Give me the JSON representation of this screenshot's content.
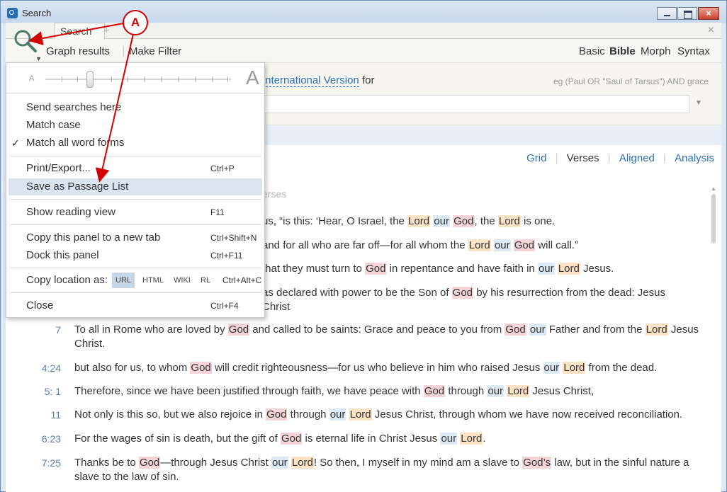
{
  "window": {
    "title": "Search"
  },
  "tabs": {
    "active_label": "Search",
    "add_label": "+",
    "close_label": "×"
  },
  "toolbar": {
    "graph_results": "Graph results",
    "make_filter": "Make Filter",
    "modes": [
      "Basic",
      "Bible",
      "Morph",
      "Syntax"
    ],
    "active_mode": "Bible"
  },
  "search": {
    "version": "International Version",
    "for_label": "for",
    "example": "eg (Paul OR \"Saul of Tarsus\") AND grace",
    "query": ""
  },
  "views": {
    "items": [
      "Grid",
      "Verses",
      "Aligned",
      "Analysis"
    ],
    "active": "Verses"
  },
  "results": {
    "summary_fragment": "erses",
    "verses": [
      {
        "ref": "",
        "parts": [
          [
            "t",
            "us, “is this: ‘Hear, O Israel, the "
          ],
          [
            "L",
            "Lord"
          ],
          [
            "t",
            " "
          ],
          [
            "O",
            "our"
          ],
          [
            "t",
            " "
          ],
          [
            "G",
            "God"
          ],
          [
            "t",
            ", the "
          ],
          [
            "L",
            "Lord"
          ],
          [
            "t",
            " is one."
          ]
        ]
      },
      {
        "ref": "",
        "parts": [
          [
            "t",
            "and for all who are far off—for all whom the "
          ],
          [
            "L",
            "Lord"
          ],
          [
            "t",
            " "
          ],
          [
            "O",
            "our"
          ],
          [
            "t",
            " "
          ],
          [
            "G",
            "God"
          ],
          [
            "t",
            " will call.”"
          ]
        ]
      },
      {
        "ref": "",
        "parts": [
          [
            "t",
            "that they must turn to "
          ],
          [
            "G",
            "God"
          ],
          [
            "t",
            " in repentance and have faith in "
          ],
          [
            "O",
            "our"
          ],
          [
            "t",
            " "
          ],
          [
            "L",
            "Lord"
          ],
          [
            "t",
            " Jesus."
          ]
        ]
      },
      {
        "ref": "",
        "parts": [
          [
            "t",
            "as declared with power to be the Son of "
          ],
          [
            "G",
            "God"
          ],
          [
            "t",
            " by his resurrection from the dead: Jesus Christ"
          ]
        ]
      },
      {
        "ref": "7",
        "parts": [
          [
            "t",
            "To all in Rome who are loved by "
          ],
          [
            "G",
            "God"
          ],
          [
            "t",
            " and called to be saints: Grace and peace to you from "
          ],
          [
            "G",
            "God"
          ],
          [
            "t",
            " "
          ],
          [
            "O",
            "our"
          ],
          [
            "t",
            " Father and from the "
          ],
          [
            "L",
            "Lord"
          ],
          [
            "t",
            " Jesus Christ."
          ]
        ]
      },
      {
        "ref": "4:24",
        "parts": [
          [
            "t",
            "but also for us, to whom "
          ],
          [
            "G",
            "God"
          ],
          [
            "t",
            " will credit righteousness—for us who believe in him who raised Jesus "
          ],
          [
            "O",
            "our"
          ],
          [
            "t",
            " "
          ],
          [
            "L",
            "Lord"
          ],
          [
            "t",
            " from the dead."
          ]
        ]
      },
      {
        "ref": "5:  1",
        "parts": [
          [
            "t",
            " Therefore, since we have been justified through faith, we have peace with "
          ],
          [
            "G",
            "God"
          ],
          [
            "t",
            " through "
          ],
          [
            "O",
            "our"
          ],
          [
            "t",
            " "
          ],
          [
            "L",
            "Lord"
          ],
          [
            "t",
            " Jesus Christ,"
          ]
        ]
      },
      {
        "ref": "11",
        "parts": [
          [
            "t",
            "Not only is this so, but we also rejoice in "
          ],
          [
            "G",
            "God"
          ],
          [
            "t",
            " through "
          ],
          [
            "O",
            "our"
          ],
          [
            "t",
            " "
          ],
          [
            "L",
            "Lord"
          ],
          [
            "t",
            " Jesus Christ, through whom we have now received reconciliation."
          ]
        ]
      },
      {
        "ref": "6:23",
        "parts": [
          [
            "t",
            "For the wages of sin is death, but the gift of "
          ],
          [
            "G",
            "God"
          ],
          [
            "t",
            " is eternal life in Christ Jesus "
          ],
          [
            "O",
            "our"
          ],
          [
            "t",
            " "
          ],
          [
            "L",
            "Lord"
          ],
          [
            "t",
            "."
          ]
        ]
      },
      {
        "ref": "7:25",
        "parts": [
          [
            "t",
            "Thanks be to "
          ],
          [
            "G",
            "God"
          ],
          [
            "t",
            "—through Jesus Christ "
          ],
          [
            "O",
            "our"
          ],
          [
            "t",
            " "
          ],
          [
            "L",
            "Lord"
          ],
          [
            "t",
            "! So then, I myself in my mind am a slave to "
          ],
          [
            "G",
            "God’s"
          ],
          [
            "t",
            " law, but in the sinful nature a slave to the law of sin."
          ]
        ]
      }
    ]
  },
  "menu": {
    "font_small": "A",
    "font_large": "A",
    "send_searches": "Send searches here",
    "match_case": "Match case",
    "match_all_forms": "Match all word forms",
    "check_mark": "✓",
    "print_export": "Print/Export...",
    "print_shortcut": "Ctrl+P",
    "save_passage_list": "Save as Passage List",
    "show_reading_view": "Show reading view",
    "reading_shortcut": "F11",
    "copy_panel": "Copy this panel to a new tab",
    "copy_panel_shortcut": "Ctrl+Shift+N",
    "dock_panel": "Dock this panel",
    "dock_shortcut": "Ctrl+F11",
    "copy_location": "Copy location as:",
    "location_formats": [
      "URL",
      "HTML",
      "WIKI",
      "RL"
    ],
    "location_shortcut": "Ctrl+Alt+C",
    "close": "Close",
    "close_shortcut": "Ctrl+F4"
  },
  "annotation": {
    "label": "A",
    "color": "#d40000"
  },
  "colors": {
    "lord_highlight": "#fde3c6",
    "god_highlight": "#f5d4d8",
    "our_highlight": "#ddeaf6",
    "link": "#2e6fb5"
  }
}
